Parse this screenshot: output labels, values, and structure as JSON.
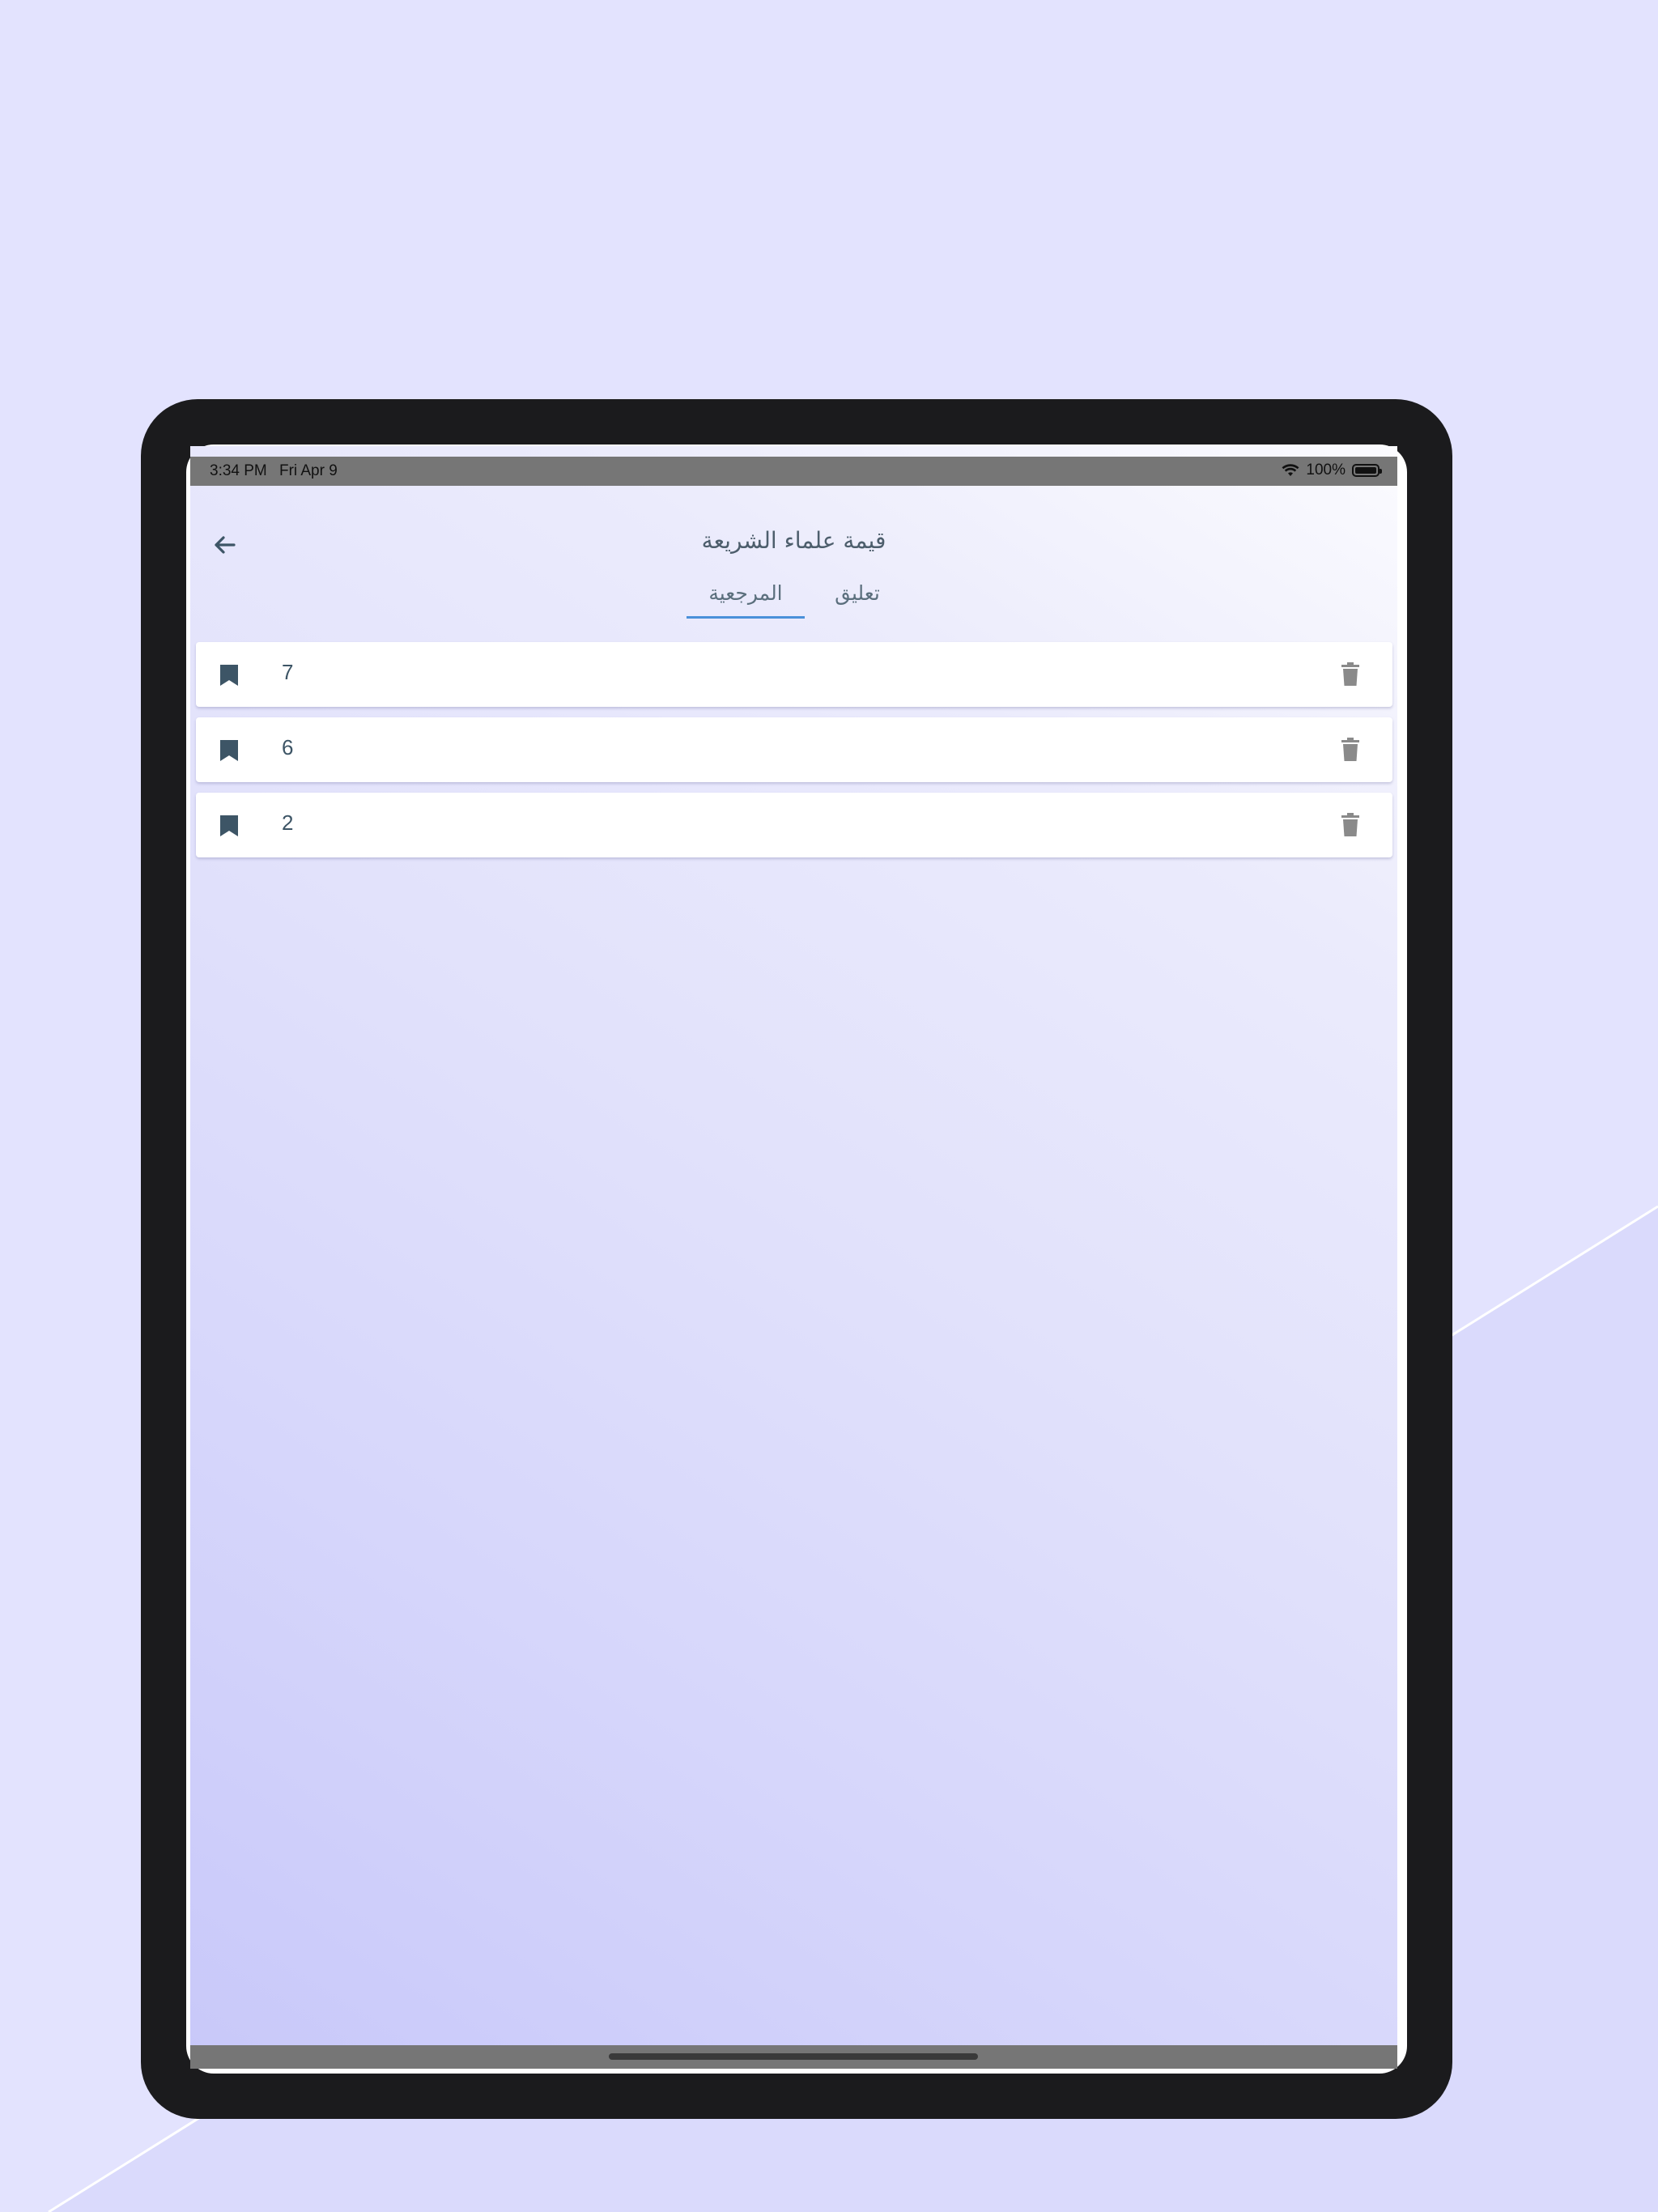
{
  "status_bar": {
    "time": "3:34 PM",
    "date": "Fri Apr 9",
    "battery": "100%",
    "wifi_icon": "wifi-icon",
    "battery_icon": "battery-icon"
  },
  "header": {
    "title": "قيمة علماء الشريعة",
    "back_icon": "arrow-left-icon"
  },
  "tabs": [
    {
      "label": "المرجعية",
      "active": true
    },
    {
      "label": "تعليق",
      "active": false
    }
  ],
  "colors": {
    "accent": "#4a90d9",
    "icon": "#3d5566",
    "trash": "#8a8a8a"
  },
  "list": [
    {
      "value": "7",
      "icon": "bookmark-icon",
      "action_icon": "trash-icon"
    },
    {
      "value": "6",
      "icon": "bookmark-icon",
      "action_icon": "trash-icon"
    },
    {
      "value": "2",
      "icon": "bookmark-icon",
      "action_icon": "trash-icon"
    }
  ]
}
